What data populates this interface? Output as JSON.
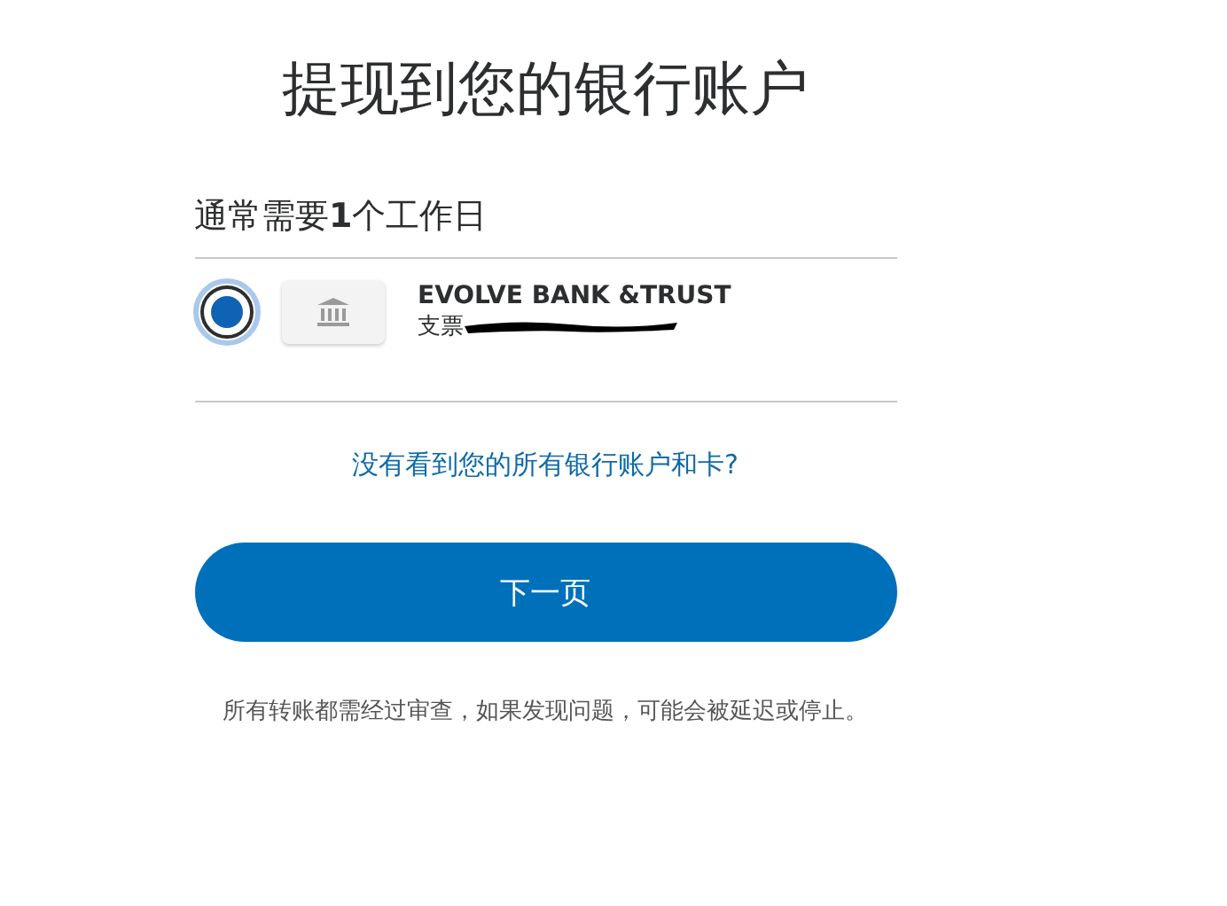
{
  "title": "提现到您的银行账户",
  "subtitle": "通常需要**1**个工作日",
  "accounts": [
    {
      "name": "EVOLVE BANK &TRUST",
      "type": "支票",
      "selected": true
    }
  ],
  "link": "没有看到您的所有银行账户和卡?",
  "button": "下一页",
  "notice": "所有转账都需经过审查，如果发现问题，可能会被延迟或停止。"
}
